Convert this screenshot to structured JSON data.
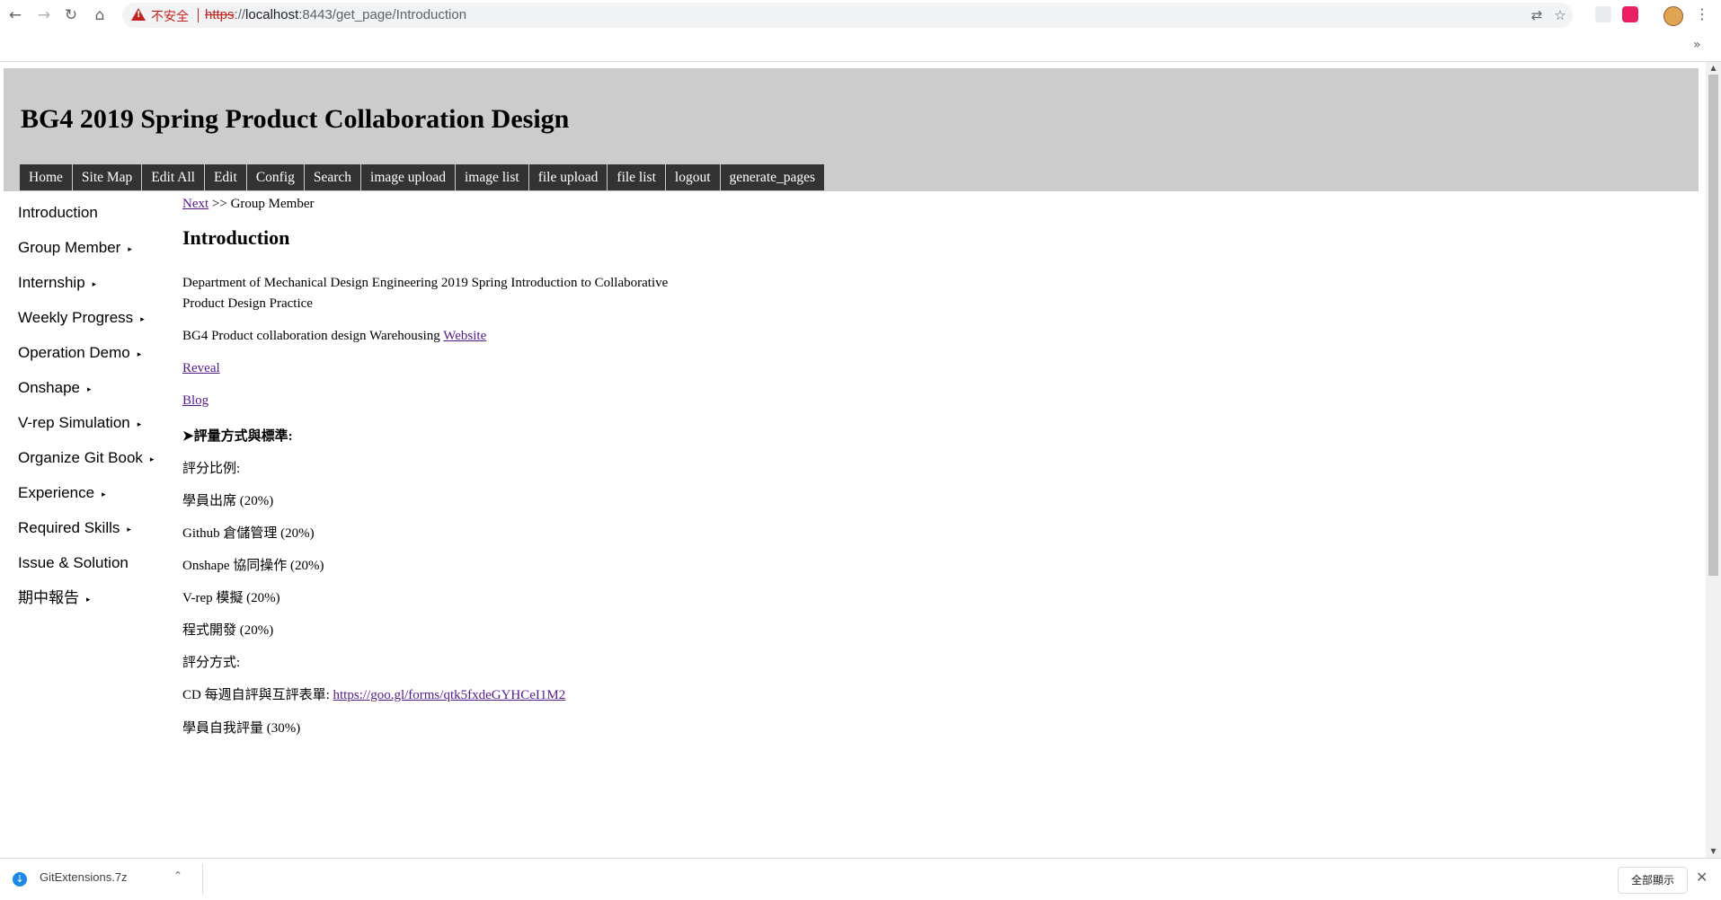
{
  "browser": {
    "security_label": "不安全",
    "url_scheme": "https",
    "url_sep": "://",
    "url_host": "localhost",
    "url_rest": ":8443/get_page/Introduction",
    "bookmarks_more": "»"
  },
  "site": {
    "title": "BG4 2019 Spring Product Collaboration Design",
    "menu": [
      "Home",
      "Site Map",
      "Edit All",
      "Edit",
      "Config",
      "Search",
      "image upload",
      "image list",
      "file upload",
      "file list",
      "logout",
      "generate_pages"
    ]
  },
  "sidebar": {
    "items": [
      {
        "label": "Introduction",
        "arrow": ""
      },
      {
        "label": "Group Member",
        "arrow": "▸"
      },
      {
        "label": "Internship",
        "arrow": "▸"
      },
      {
        "label": "Weekly Progress",
        "arrow": "▸"
      },
      {
        "label": "Operation Demo",
        "arrow": "▸"
      },
      {
        "label": "Onshape",
        "arrow": "▸"
      },
      {
        "label": "V-rep Simulation",
        "arrow": "▸"
      },
      {
        "label": "Organize Git Book",
        "arrow": "▸"
      },
      {
        "label": "Experience",
        "arrow": "▸"
      },
      {
        "label": "Required Skills",
        "arrow": "▸"
      },
      {
        "label": "Issue & Solution",
        "arrow": ""
      },
      {
        "label": "期中報告",
        "arrow": "▸"
      }
    ]
  },
  "content": {
    "breadcrumb_link": "Next",
    "breadcrumb_rest": " >> Group Member",
    "heading": "Introduction",
    "intro_line1": "Department of Mechanical Design Engineering 2019 Spring Introduction to Collaborative",
    "intro_line2": "Product Design Practice",
    "warehouse_text": "BG4 Product collaboration design Warehousing ",
    "warehouse_link": "Website",
    "reveal_link": "Reveal",
    "blog_link": "Blog",
    "grading_heading": "➤評量方式與標準:",
    "ratio_label": "評分比例:",
    "items": [
      "學員出席 (20%)",
      "Github 倉儲管理  (20%)",
      "Onshape 協同操作 (20%)",
      "V-rep 模擬 (20%)",
      "程式開發 (20%)"
    ],
    "method_label": "評分方式:",
    "form_text": "CD 每週自評與互評表單: ",
    "form_link": "https://goo.gl/forms/qtk5fxdeGYHCeI1M2",
    "self_eval": "學員自我評量 (30%)"
  },
  "download": {
    "filename": "GitExtensions.7z",
    "show_all": "全部顯示"
  }
}
